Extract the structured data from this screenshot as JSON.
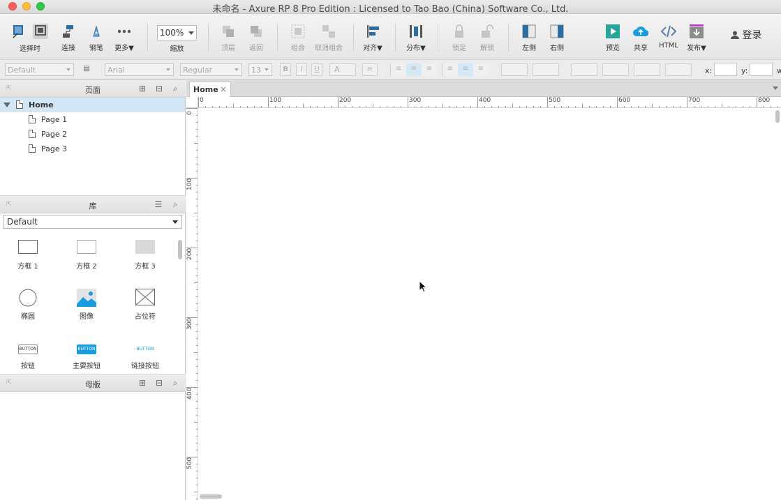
{
  "window": {
    "title": "未命名 - Axure RP 8 Pro Edition : Licensed to Tao Bao (China) Software Co., Ltd."
  },
  "toolbar": {
    "select_label": "选择时",
    "connect_label": "连接",
    "pen_label": "钢笔",
    "more_label": "更多▼",
    "zoom_value": "100%",
    "zoom_label": "缩放",
    "top_label": "顶层",
    "back_label": "返回",
    "group_label": "组合",
    "ungroup_label": "取消组合",
    "align_label": "对齐▼",
    "distribute_label": "分布▼",
    "lock_label": "锁定",
    "unlock_label": "解锁",
    "left_label": "左侧",
    "right_label": "右侧",
    "preview_label": "预览",
    "share_label": "共享",
    "html_label": "HTML",
    "publish_label": "发布▼",
    "login_label": "登录"
  },
  "format": {
    "style_value": "Default",
    "font_value": "Arial",
    "weight_value": "Regular",
    "size_value": "13",
    "x_label": "x:",
    "y_label": "y:",
    "w_label": "w"
  },
  "pages_panel": {
    "title": "页面",
    "items": [
      {
        "label": "Home"
      },
      {
        "label": "Page 1"
      },
      {
        "label": "Page 2"
      },
      {
        "label": "Page 3"
      }
    ]
  },
  "library_panel": {
    "title": "库",
    "selected_library": "Default",
    "widgets": [
      {
        "label": "方框 1"
      },
      {
        "label": "方框 2"
      },
      {
        "label": "方框 3"
      },
      {
        "label": "椭圆"
      },
      {
        "label": "图像"
      },
      {
        "label": "占位符"
      },
      {
        "label": "按钮",
        "caption": "BUTTON"
      },
      {
        "label": "主要按钮",
        "caption": "BUTTON"
      },
      {
        "label": "链接按钮",
        "caption": "BUTTON"
      }
    ]
  },
  "masters_panel": {
    "title": "母版"
  },
  "canvas": {
    "tab_label": "Home",
    "tab_close": "×",
    "h_ruler": [
      "0",
      "100",
      "200",
      "300",
      "400",
      "500",
      "600",
      "700",
      "800"
    ],
    "v_ruler": [
      "0",
      "100",
      "200",
      "300",
      "400",
      "500"
    ]
  },
  "colors": {
    "accent": "#1a9ce0",
    "preview": "#26a69a",
    "publish": "#b845c7",
    "selection": "#d3e6f5"
  }
}
